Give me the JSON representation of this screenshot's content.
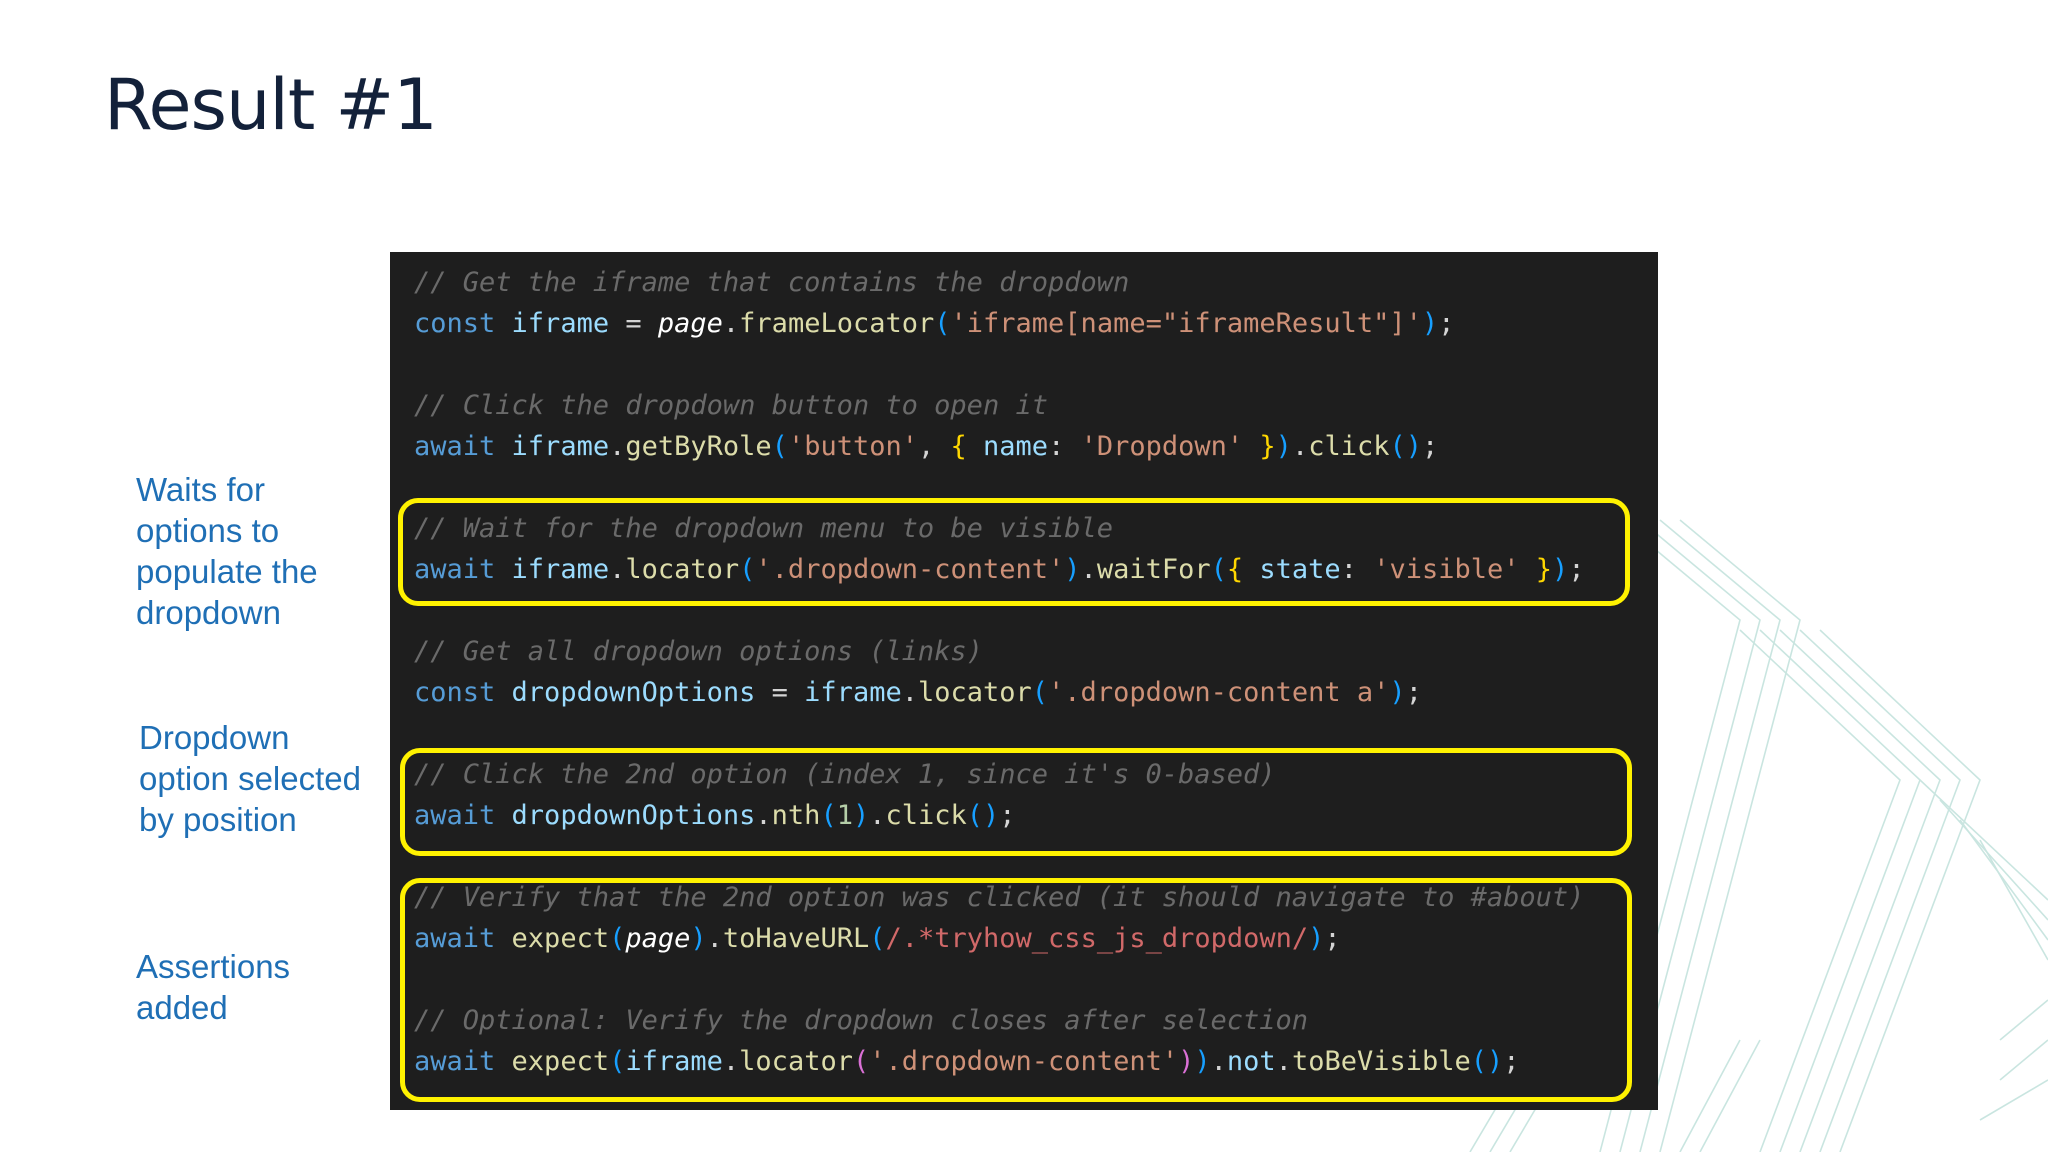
{
  "slide": {
    "title": "Result #1"
  },
  "annotations": [
    {
      "text": "Waits for options to populate the dropdown"
    },
    {
      "text": "Dropdown option selected by position"
    },
    {
      "text": "Assertions added"
    }
  ],
  "colors": {
    "highlight": "#fff200",
    "code_background": "#1e1e1e",
    "annotation_text": "#1f6fb5",
    "title_text": "#13213a"
  },
  "code": {
    "lines": [
      [
        {
          "t": "// Get the iframe that contains the dropdown",
          "c": "comment"
        }
      ],
      [
        {
          "t": "const",
          "c": "keyword"
        },
        {
          "t": " ",
          "c": "plain"
        },
        {
          "t": "iframe",
          "c": "variable"
        },
        {
          "t": " = ",
          "c": "plain"
        },
        {
          "t": "page",
          "c": "italic"
        },
        {
          "t": ".",
          "c": "punct"
        },
        {
          "t": "frameLocator",
          "c": "func"
        },
        {
          "t": "(",
          "c": "bracket3"
        },
        {
          "t": "'iframe[name=\"iframeResult\"]'",
          "c": "string"
        },
        {
          "t": ")",
          "c": "bracket3"
        },
        {
          "t": ";",
          "c": "punct"
        }
      ],
      [],
      [
        {
          "t": "// Click the dropdown button to open it",
          "c": "comment"
        }
      ],
      [
        {
          "t": "await",
          "c": "keyword"
        },
        {
          "t": " ",
          "c": "plain"
        },
        {
          "t": "iframe",
          "c": "variable"
        },
        {
          "t": ".",
          "c": "punct"
        },
        {
          "t": "getByRole",
          "c": "func"
        },
        {
          "t": "(",
          "c": "bracket3"
        },
        {
          "t": "'button'",
          "c": "string"
        },
        {
          "t": ", ",
          "c": "punct"
        },
        {
          "t": "{",
          "c": "bracket1"
        },
        {
          "t": " ",
          "c": "plain"
        },
        {
          "t": "name",
          "c": "variable"
        },
        {
          "t": ": ",
          "c": "punct"
        },
        {
          "t": "'Dropdown'",
          "c": "string"
        },
        {
          "t": " ",
          "c": "plain"
        },
        {
          "t": "}",
          "c": "bracket1"
        },
        {
          "t": ")",
          "c": "bracket3"
        },
        {
          "t": ".",
          "c": "punct"
        },
        {
          "t": "click",
          "c": "func"
        },
        {
          "t": "()",
          "c": "bracket3"
        },
        {
          "t": ";",
          "c": "punct"
        }
      ],
      [],
      [
        {
          "t": "// Wait for the dropdown menu to be visible",
          "c": "comment"
        }
      ],
      [
        {
          "t": "await",
          "c": "keyword"
        },
        {
          "t": " ",
          "c": "plain"
        },
        {
          "t": "iframe",
          "c": "variable"
        },
        {
          "t": ".",
          "c": "punct"
        },
        {
          "t": "locator",
          "c": "func"
        },
        {
          "t": "(",
          "c": "bracket3"
        },
        {
          "t": "'.dropdown-content'",
          "c": "string"
        },
        {
          "t": ")",
          "c": "bracket3"
        },
        {
          "t": ".",
          "c": "punct"
        },
        {
          "t": "waitFor",
          "c": "func"
        },
        {
          "t": "(",
          "c": "bracket3"
        },
        {
          "t": "{",
          "c": "bracket1"
        },
        {
          "t": " ",
          "c": "plain"
        },
        {
          "t": "state",
          "c": "variable"
        },
        {
          "t": ": ",
          "c": "punct"
        },
        {
          "t": "'visible'",
          "c": "string"
        },
        {
          "t": " ",
          "c": "plain"
        },
        {
          "t": "}",
          "c": "bracket1"
        },
        {
          "t": ")",
          "c": "bracket3"
        },
        {
          "t": ";",
          "c": "punct"
        }
      ],
      [],
      [
        {
          "t": "// Get all dropdown options (links)",
          "c": "comment"
        }
      ],
      [
        {
          "t": "const",
          "c": "keyword"
        },
        {
          "t": " ",
          "c": "plain"
        },
        {
          "t": "dropdownOptions",
          "c": "variable"
        },
        {
          "t": " = ",
          "c": "plain"
        },
        {
          "t": "iframe",
          "c": "variable"
        },
        {
          "t": ".",
          "c": "punct"
        },
        {
          "t": "locator",
          "c": "func"
        },
        {
          "t": "(",
          "c": "bracket3"
        },
        {
          "t": "'.dropdown-content a'",
          "c": "string"
        },
        {
          "t": ")",
          "c": "bracket3"
        },
        {
          "t": ";",
          "c": "punct"
        }
      ],
      [],
      [
        {
          "t": "// Click the 2nd option (index 1, since it's 0-based)",
          "c": "comment"
        }
      ],
      [
        {
          "t": "await",
          "c": "keyword"
        },
        {
          "t": " ",
          "c": "plain"
        },
        {
          "t": "dropdownOptions",
          "c": "variable"
        },
        {
          "t": ".",
          "c": "punct"
        },
        {
          "t": "nth",
          "c": "func"
        },
        {
          "t": "(",
          "c": "bracket3"
        },
        {
          "t": "1",
          "c": "number"
        },
        {
          "t": ")",
          "c": "bracket3"
        },
        {
          "t": ".",
          "c": "punct"
        },
        {
          "t": "click",
          "c": "func"
        },
        {
          "t": "()",
          "c": "bracket3"
        },
        {
          "t": ";",
          "c": "punct"
        }
      ],
      [],
      [
        {
          "t": "// Verify that the 2nd option was clicked (it should navigate to #about)",
          "c": "comment"
        }
      ],
      [
        {
          "t": "await",
          "c": "keyword"
        },
        {
          "t": " ",
          "c": "plain"
        },
        {
          "t": "expect",
          "c": "func"
        },
        {
          "t": "(",
          "c": "bracket3"
        },
        {
          "t": "page",
          "c": "italic"
        },
        {
          "t": ")",
          "c": "bracket3"
        },
        {
          "t": ".",
          "c": "punct"
        },
        {
          "t": "toHaveURL",
          "c": "func"
        },
        {
          "t": "(",
          "c": "bracket3"
        },
        {
          "t": "/.*tryhow_css_js_dropdown/",
          "c": "regex"
        },
        {
          "t": ")",
          "c": "bracket3"
        },
        {
          "t": ";",
          "c": "punct"
        }
      ],
      [],
      [
        {
          "t": "// Optional: Verify the dropdown closes after selection",
          "c": "comment"
        }
      ],
      [
        {
          "t": "await",
          "c": "keyword"
        },
        {
          "t": " ",
          "c": "plain"
        },
        {
          "t": "expect",
          "c": "func"
        },
        {
          "t": "(",
          "c": "bracket3"
        },
        {
          "t": "iframe",
          "c": "variable"
        },
        {
          "t": ".",
          "c": "punct"
        },
        {
          "t": "locator",
          "c": "func"
        },
        {
          "t": "(",
          "c": "bracket2"
        },
        {
          "t": "'.dropdown-content'",
          "c": "string"
        },
        {
          "t": ")",
          "c": "bracket2"
        },
        {
          "t": ")",
          "c": "bracket3"
        },
        {
          "t": ".",
          "c": "punct"
        },
        {
          "t": "not",
          "c": "variable"
        },
        {
          "t": ".",
          "c": "punct"
        },
        {
          "t": "toBeVisible",
          "c": "func"
        },
        {
          "t": "()",
          "c": "bracket3"
        },
        {
          "t": ";",
          "c": "punct"
        }
      ]
    ]
  }
}
